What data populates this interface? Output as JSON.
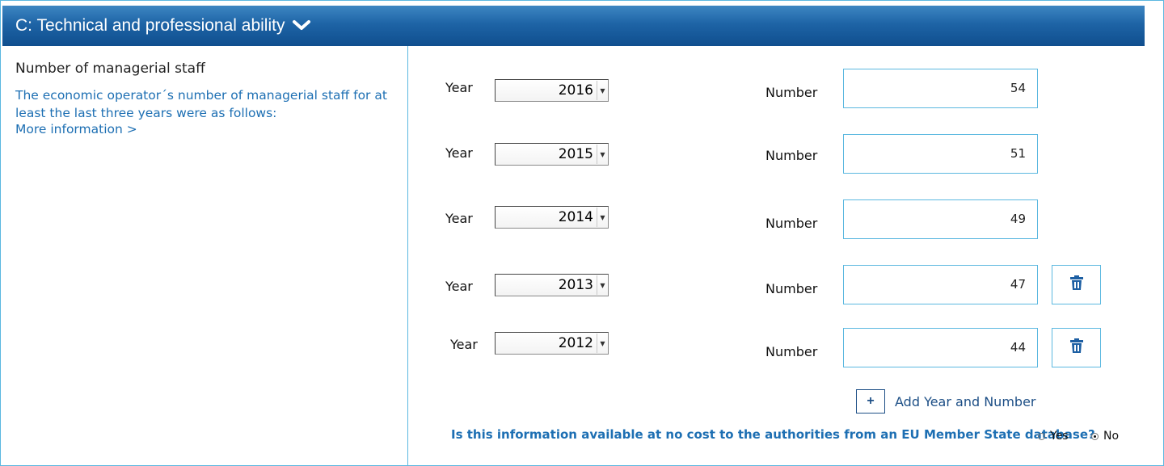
{
  "section": {
    "title": "C: Technical and professional ability",
    "collapse_icon": "chevron-down-icon"
  },
  "criterion": {
    "title": "Number of managerial staff",
    "description": "The economic operator´s number of managerial staff for at least the last three years were as follows:",
    "more_info": "More information >"
  },
  "rows": [
    {
      "year_label": "Year",
      "year": "2016",
      "number_label": "Number",
      "number": "54",
      "deletable": false
    },
    {
      "year_label": "Year",
      "year": "2015",
      "number_label": "Number",
      "number": "51",
      "deletable": false
    },
    {
      "year_label": "Year",
      "year": "2014",
      "number_label": "Number",
      "number": "49",
      "deletable": false
    },
    {
      "year_label": "Year",
      "year": "2013",
      "number_label": "Number",
      "number": "47",
      "deletable": true
    },
    {
      "year_label": "Year",
      "year": "2012",
      "number_label": "Number",
      "number": "44",
      "deletable": true
    }
  ],
  "add": {
    "icon": "+",
    "label": "Add Year and Number"
  },
  "question": {
    "text": "Is this information available at no cost to the authorities from an EU Member State database?",
    "options": [
      {
        "label": "Yes",
        "checked": false
      },
      {
        "label": "No",
        "checked": true
      }
    ]
  },
  "colors": {
    "header_top": "#3d86c2",
    "header_bottom": "#0f4e8e",
    "link_blue": "#1d6fb3",
    "border_cyan": "#5bb8e0",
    "button_navy": "#1d4f86"
  }
}
